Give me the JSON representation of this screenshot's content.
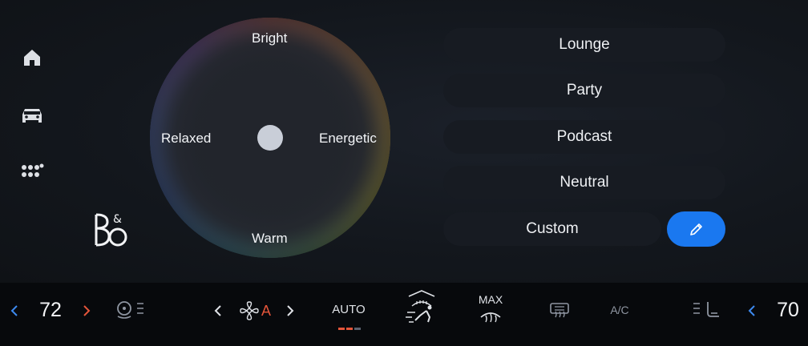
{
  "sidebar": {
    "items": [
      {
        "name": "home",
        "icon": "home-icon"
      },
      {
        "name": "vehicle",
        "icon": "car-icon"
      },
      {
        "name": "apps",
        "icon": "apps-grid-icon"
      }
    ],
    "brand": "B&O"
  },
  "sound_mood": {
    "labels": {
      "top": "Bright",
      "left": "Relaxed",
      "right": "Energetic",
      "bottom": "Warm"
    }
  },
  "presets": {
    "items": [
      "Lounge",
      "Party",
      "Podcast",
      "Neutral"
    ],
    "custom": "Custom",
    "edit_icon": "pencil-icon"
  },
  "climate": {
    "driver_temp": "72",
    "passenger_temp": "70",
    "fan_mode": "A",
    "auto_label": "AUTO",
    "max_label": "MAX",
    "ac_label": "A/C",
    "accent": "#3d8af0",
    "heat_accent": "#e4553a"
  }
}
